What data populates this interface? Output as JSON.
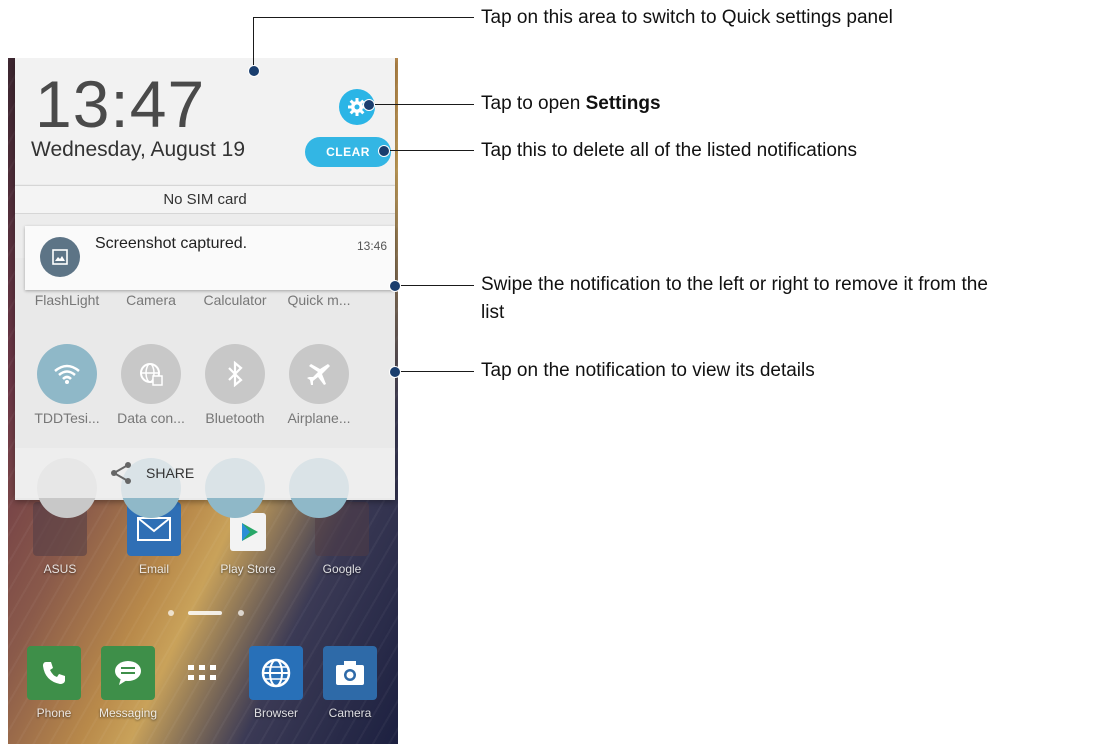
{
  "notification_shade": {
    "time": "13:47",
    "date": "Wednesday, August 19",
    "clear_label": "CLEAR",
    "sim_status": "No SIM card"
  },
  "notification": {
    "title": "Screenshot captured.",
    "time": "13:46"
  },
  "quick_settings": {
    "items": [
      {
        "label": "FlashLight",
        "icon": "flashlight-icon"
      },
      {
        "label": "Camera",
        "icon": "camera-icon"
      },
      {
        "label": "Calculator",
        "icon": "calculator-icon"
      },
      {
        "label": "Quick m...",
        "icon": "quick-memo-icon"
      },
      {
        "label": "TDDTesi...",
        "icon": "wifi-icon"
      },
      {
        "label": "Data con...",
        "icon": "data-connection-icon"
      },
      {
        "label": "Bluetooth",
        "icon": "bluetooth-icon"
      },
      {
        "label": "Airplane...",
        "icon": "airplane-icon"
      }
    ],
    "share_label": "SHARE"
  },
  "home_apps": [
    {
      "label": "ASUS",
      "icon": "asus-folder-icon"
    },
    {
      "label": "Email",
      "icon": "email-icon"
    },
    {
      "label": "Play Store",
      "icon": "play-store-icon"
    },
    {
      "label": "Google",
      "icon": "google-folder-icon"
    }
  ],
  "dock": [
    {
      "label": "Phone",
      "icon": "phone-icon"
    },
    {
      "label": "Messaging",
      "icon": "messaging-icon"
    },
    {
      "label": "",
      "icon": "app-drawer-icon"
    },
    {
      "label": "Browser",
      "icon": "browser-icon"
    },
    {
      "label": "Camera",
      "icon": "camera-icon"
    }
  ],
  "callouts": {
    "quick_settings": "Tap on this area to switch to Quick settings panel",
    "settings_prefix": "Tap to open ",
    "settings_bold": "Settings",
    "clear": "Tap this to delete all of the listed notifications",
    "swipe_line1": "Swipe the notification to the left or right to remove it from the",
    "swipe_line2": "list",
    "view": "Tap on the notification to view its details"
  },
  "colors": {
    "accent": "#33b6e4",
    "callout_dot": "#1a3e6e"
  }
}
